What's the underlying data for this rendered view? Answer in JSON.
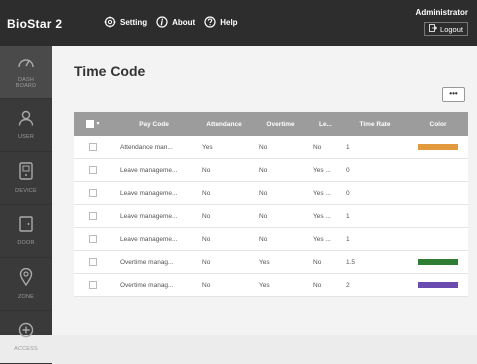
{
  "header": {
    "brand": "BioStar 2",
    "nav": [
      {
        "label": "Setting",
        "icon": "gear-icon"
      },
      {
        "label": "About",
        "icon": "info-icon"
      },
      {
        "label": "Help",
        "icon": "question-icon"
      }
    ],
    "user": "Administrator",
    "logout": "Logout"
  },
  "sidebar": {
    "items": [
      {
        "label_line1": "DASH",
        "label_line2": "BOARD",
        "icon": "dashboard-gauge-icon"
      },
      {
        "label_line1": "USER",
        "label_line2": "",
        "icon": "user-icon"
      },
      {
        "label_line1": "DEVICE",
        "label_line2": "",
        "icon": "device-icon"
      },
      {
        "label_line1": "DOOR",
        "label_line2": "",
        "icon": "door-icon"
      },
      {
        "label_line1": "ZONE",
        "label_line2": "",
        "icon": "zone-pin-icon"
      },
      {
        "label_line1": "ACCESS",
        "label_line2": "",
        "icon": "access-plus-icon"
      }
    ],
    "collapse_glyph": "›"
  },
  "page": {
    "title": "Time Code",
    "more_label": "•••"
  },
  "table": {
    "columns": [
      "Pay Code",
      "Attendance",
      "Overtime",
      "Le...",
      "Time Rate",
      "Color"
    ],
    "header_caret": "▼",
    "rows": [
      {
        "pay_code": "Attendance man...",
        "attendance": "Yes",
        "overtime": "No",
        "leave": "No",
        "time_rate": "1",
        "color": "#e39a3e"
      },
      {
        "pay_code": "Leave manageme...",
        "attendance": "No",
        "overtime": "No",
        "leave": "Yes ...",
        "time_rate": "0",
        "color": ""
      },
      {
        "pay_code": "Leave manageme...",
        "attendance": "No",
        "overtime": "No",
        "leave": "Yes ...",
        "time_rate": "0",
        "color": ""
      },
      {
        "pay_code": "Leave manageme...",
        "attendance": "No",
        "overtime": "No",
        "leave": "Yes ...",
        "time_rate": "1",
        "color": ""
      },
      {
        "pay_code": "Leave manageme...",
        "attendance": "No",
        "overtime": "No",
        "leave": "Yes ...",
        "time_rate": "1",
        "color": ""
      },
      {
        "pay_code": "Overtime manag...",
        "attendance": "No",
        "overtime": "Yes",
        "leave": "No",
        "time_rate": "1.5",
        "color": "#2e7d32"
      },
      {
        "pay_code": "Overtime manag...",
        "attendance": "No",
        "overtime": "Yes",
        "leave": "No",
        "time_rate": "2",
        "color": "#6a4bb0"
      }
    ]
  }
}
